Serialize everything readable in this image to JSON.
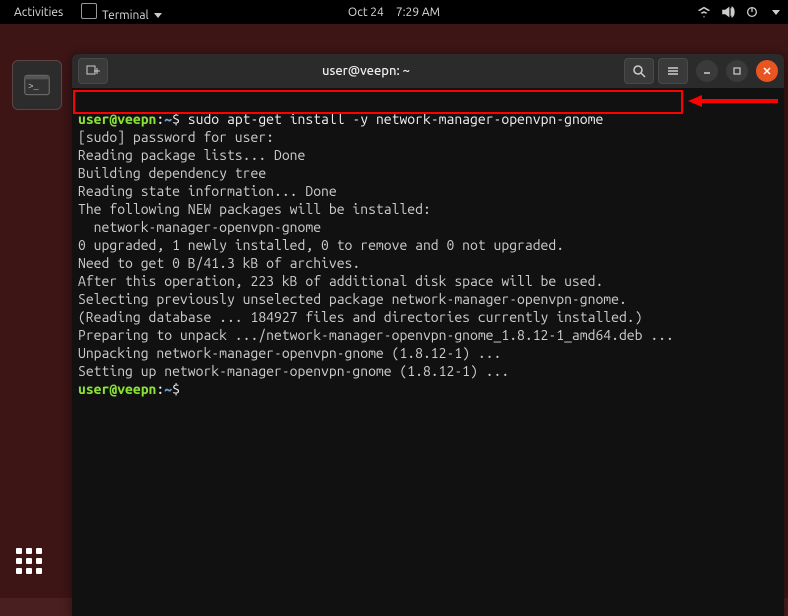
{
  "topbar": {
    "activities": "Activities",
    "terminal": "Terminal",
    "date": "Oct 24",
    "time": "7:29 AM"
  },
  "window": {
    "title": "user@veepn: ~"
  },
  "prompt1": {
    "user": "user@veepn",
    "path": "~",
    "command": "sudo apt-get install -y network-manager-openvpn-gnome"
  },
  "output": [
    "[sudo] password for user:",
    "Reading package lists... Done",
    "Building dependency tree",
    "Reading state information... Done",
    "The following NEW packages will be installed:",
    "  network-manager-openvpn-gnome",
    "0 upgraded, 1 newly installed, 0 to remove and 0 not upgraded.",
    "Need to get 0 B/41.3 kB of archives.",
    "After this operation, 223 kB of additional disk space will be used.",
    "Selecting previously unselected package network-manager-openvpn-gnome.",
    "(Reading database ... 184927 files and directories currently installed.)",
    "Preparing to unpack .../network-manager-openvpn-gnome_1.8.12-1_amd64.deb ...",
    "Unpacking network-manager-openvpn-gnome (1.8.12-1) ...",
    "Setting up network-manager-openvpn-gnome (1.8.12-1) ..."
  ],
  "prompt2": {
    "user": "user@veepn",
    "path": "~"
  }
}
